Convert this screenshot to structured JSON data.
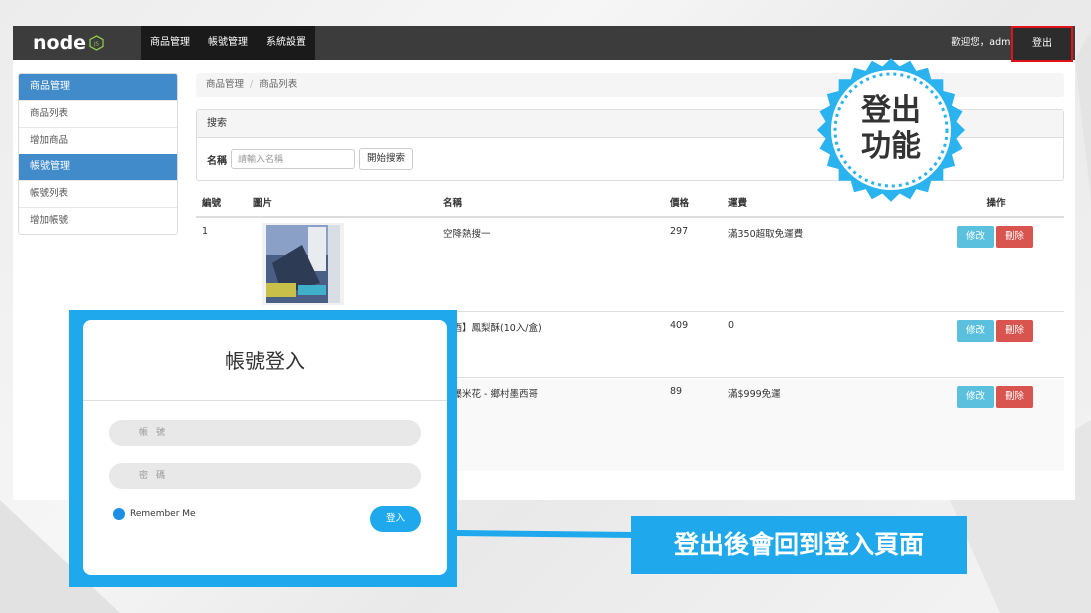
{
  "navbar": {
    "logo_text": "node",
    "logo_badge": "JS",
    "menu": [
      "商品管理",
      "帳號管理",
      "系統設置"
    ],
    "welcome": "歡迎您，admi",
    "logout_label": "登出"
  },
  "sidebar": {
    "group1_title": "商品管理",
    "group1_items": [
      "商品列表",
      "增加商品"
    ],
    "group2_title": "帳號管理",
    "group2_items": [
      "帳號列表",
      "增加帳號"
    ]
  },
  "breadcrumb": {
    "root": "商品管理",
    "sep": "/",
    "current": "商品列表"
  },
  "search": {
    "title": "搜索",
    "label": "名稱",
    "placeholder": "請輸入名稱",
    "button": "開始搜索"
  },
  "table": {
    "headers": [
      "編號",
      "圖片",
      "名稱",
      "價格",
      "運費",
      "操作"
    ],
    "rows": [
      {
        "id": "1",
        "name": "空降熱搜一",
        "price": "297",
        "shipping": "滿350超取免運費",
        "edit": "修改",
        "delete": "刪除"
      },
      {
        "id": "",
        "name": "小酒】鳳梨酥(10入/盒)",
        "price": "409",
        "shipping": "0",
        "edit": "修改",
        "delete": "刪除"
      },
      {
        "id": "",
        "name": "鍊爆米花 - 鄉村墨西哥",
        "price": "89",
        "shipping": "滿$999免運",
        "edit": "修改",
        "delete": "刪除"
      }
    ]
  },
  "badge": {
    "line1": "登出",
    "line2": "功能"
  },
  "login": {
    "title": "帳號登入",
    "username_placeholder": "帳號",
    "password_placeholder": "密碼",
    "remember": "Remember Me",
    "button": "登入"
  },
  "callout": "登出後會回到登入頁面",
  "colors": {
    "accent": "#1fa9ec",
    "navbar": "#3c3c3c",
    "sidebar_head": "#428bca",
    "danger": "#d9534f",
    "info": "#5bc0de",
    "highlight_border": "#e0131a"
  }
}
